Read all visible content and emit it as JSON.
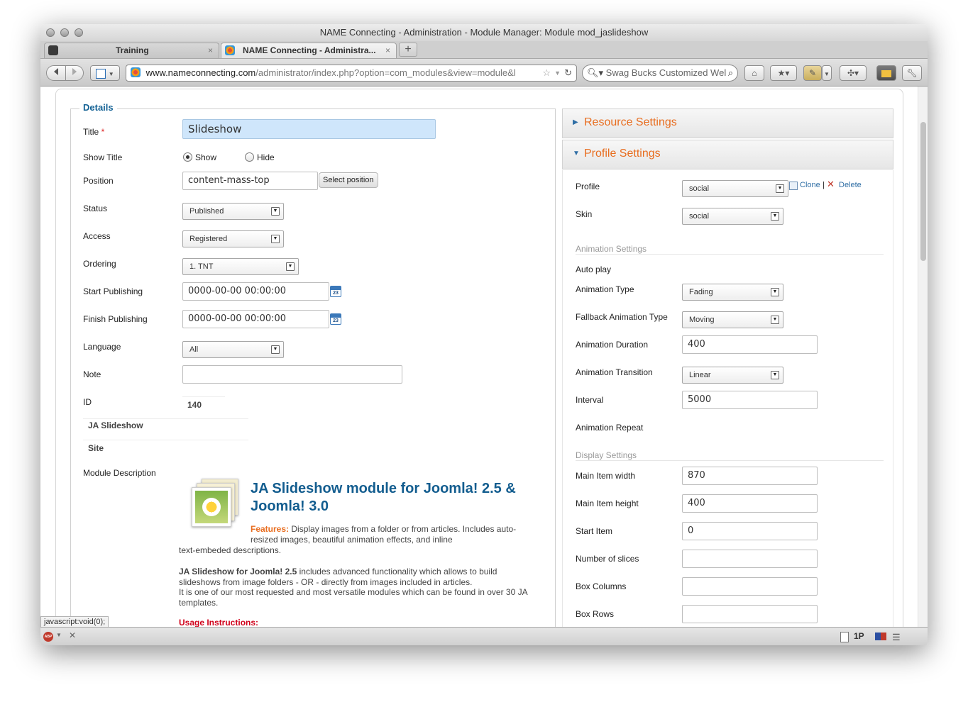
{
  "window": {
    "title": "NAME Connecting - Administration - Module Manager: Module mod_jaslideshow"
  },
  "tabs": [
    {
      "label": "Training",
      "close": "×"
    },
    {
      "label": "NAME Connecting - Administra...",
      "close": "×"
    }
  ],
  "newtab": "+",
  "url": {
    "host": "www.nameconnecting.com",
    "path": "/administrator/index.php?option=com_modules&view=module&l"
  },
  "search": {
    "text": "Swag Bucks Customized Wel"
  },
  "details": {
    "legend": "Details",
    "title_label": "Title",
    "required": "*",
    "title_value": "Slideshow",
    "show_title_label": "Show Title",
    "show_option": "Show",
    "hide_option": "Hide",
    "show_title_selected": "Show",
    "position_label": "Position",
    "position_value": "content-mass-top",
    "select_position": "Select position",
    "status_label": "Status",
    "status_value": "Published",
    "access_label": "Access",
    "access_value": "Registered",
    "ordering_label": "Ordering",
    "ordering_value": "1. TNT",
    "start_label": "Start Publishing",
    "start_value": "0000-00-00 00:00:00",
    "finish_label": "Finish Publishing",
    "finish_value": "0000-00-00 00:00:00",
    "calendar_day": "23",
    "language_label": "Language",
    "language_value": "All",
    "note_label": "Note",
    "note_value": "",
    "id_label": "ID",
    "id_value": "140",
    "module_name": "JA Slideshow",
    "site": "Site",
    "desc_label": "Module Description",
    "desc_title": "JA Slideshow module for Joomla! 2.5 & Joomla! 3.0",
    "features_label": "Features:",
    "features_text": "Display images from a folder or from articles. Includes auto-resized images, beautiful animation effects, and inline",
    "features_text2": "text-embeded descriptions.",
    "p2_bold": "JA Slideshow for Joomla! 2.5",
    "p2_text": "includes advanced functionality which allows to build",
    "p2_line2": "slideshows from image folders - OR - directly from images included in articles.",
    "p2_line3": "It is one of our most requested and most versatile modules which can be found in over 30 JA",
    "p2_line4": "templates.",
    "usage": "Usage Instructions:"
  },
  "right": {
    "resource_title": "Resource Settings",
    "profile_title": "Profile Settings",
    "profile_label": "Profile",
    "profile_value": "social",
    "clone": "Clone",
    "sep": "|",
    "delete": "Delete",
    "skin_label": "Skin",
    "skin_value": "social",
    "animation_group": "Animation Settings",
    "autoplay_label": "Auto play",
    "anim_type_label": "Animation Type",
    "anim_type_value": "Fading",
    "fallback_label": "Fallback Animation Type",
    "fallback_value": "Moving",
    "duration_label": "Animation Duration",
    "duration_value": "400",
    "transition_label": "Animation Transition",
    "transition_value": "Linear",
    "interval_label": "Interval",
    "interval_value": "5000",
    "repeat_label": "Animation Repeat",
    "display_group": "Display Settings",
    "width_label": "Main Item width",
    "width_value": "870",
    "height_label": "Main Item height",
    "height_value": "400",
    "start_label": "Start Item",
    "start_value": "0",
    "slices_label": "Number of slices",
    "slices_value": "",
    "cols_label": "Box Columns",
    "cols_value": "",
    "rows_label": "Box Rows",
    "rows_value": ""
  },
  "status": {
    "link": "javascript:void(0);",
    "abp": "ABP",
    "onep": "1P"
  }
}
